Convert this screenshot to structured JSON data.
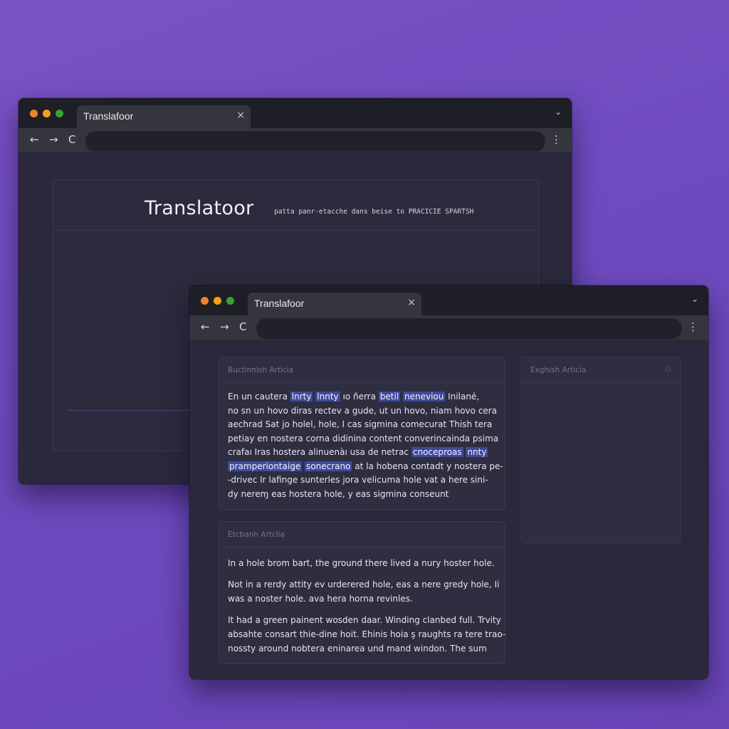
{
  "back_window": {
    "tab_title": "Translafoor",
    "brand": "Translatoor",
    "tagline": "patta panr-etacche dans beise to PRACICIE SPARTSH"
  },
  "front_window": {
    "tab_title": "Translafoor",
    "spanish_panel": {
      "title": "Buctinnish Articia",
      "lines": [
        [
          {
            "t": "En un cautera "
          },
          {
            "t": "lnrty",
            "h": true
          },
          {
            "t": " "
          },
          {
            "t": "lnnty",
            "h": true
          },
          {
            "t": " ıo ñerra "
          },
          {
            "t": "betil",
            "h": true
          },
          {
            "t": " "
          },
          {
            "t": "neneviou",
            "h": true
          },
          {
            "t": " Inilané,"
          }
        ],
        [
          {
            "t": "no sn un hovo diras rectev a gude, ut un hovo, niam hovo cera"
          }
        ],
        [
          {
            "t": "aechrad Sat jo holel, hole, I cas sigmina comecurat Thish tera"
          }
        ],
        [
          {
            "t": "petiay en nostera corna didinina content converincainda psima"
          }
        ],
        [
          {
            "t": "crafaı Iras hostera alinuenàı usa de netrac "
          },
          {
            "t": "cnoceproas",
            "h": true
          },
          {
            "t": " "
          },
          {
            "t": "nnty",
            "h": true
          }
        ],
        [
          {
            "t": "pramperiontaige",
            "h": true
          },
          {
            "t": " "
          },
          {
            "t": "sonecrano",
            "h": true
          },
          {
            "t": " at la hobena contadt y nostera pe-"
          }
        ],
        [
          {
            "t": "-drivec Ir lafinge sunterles jora velicuma hole vat a here sini-"
          }
        ],
        [
          {
            "t": "dy nereɱ eas hostera hole, y eas sigmina conseunt"
          }
        ]
      ]
    },
    "english_panel": {
      "title": "Etcbanh Artclia",
      "paragraphs": [
        [
          "In a hole brom bart, the ground there lived a nury hoster hole."
        ],
        [
          "Not in a rerdy attity ev urderered hole, eas a nere gredy hole, Ii",
          "was a noster hole. ava hera horna revinles."
        ],
        [
          "It had a green painent wosden daar. Winding clanbed full. Trvity",
          "absahte consart thie-dine hoit. Ehinis hoia ş raughts ra tere trao-",
          "nossty around nobtera eninarea und mand windon. The sum"
        ]
      ]
    },
    "output_panel": {
      "title": "Exghish Articia"
    }
  },
  "icons": {
    "close": "×",
    "chevron": "⌄",
    "back": "←",
    "forward": "→",
    "reload": "C",
    "menu": "⋮",
    "copy": "⧉"
  }
}
